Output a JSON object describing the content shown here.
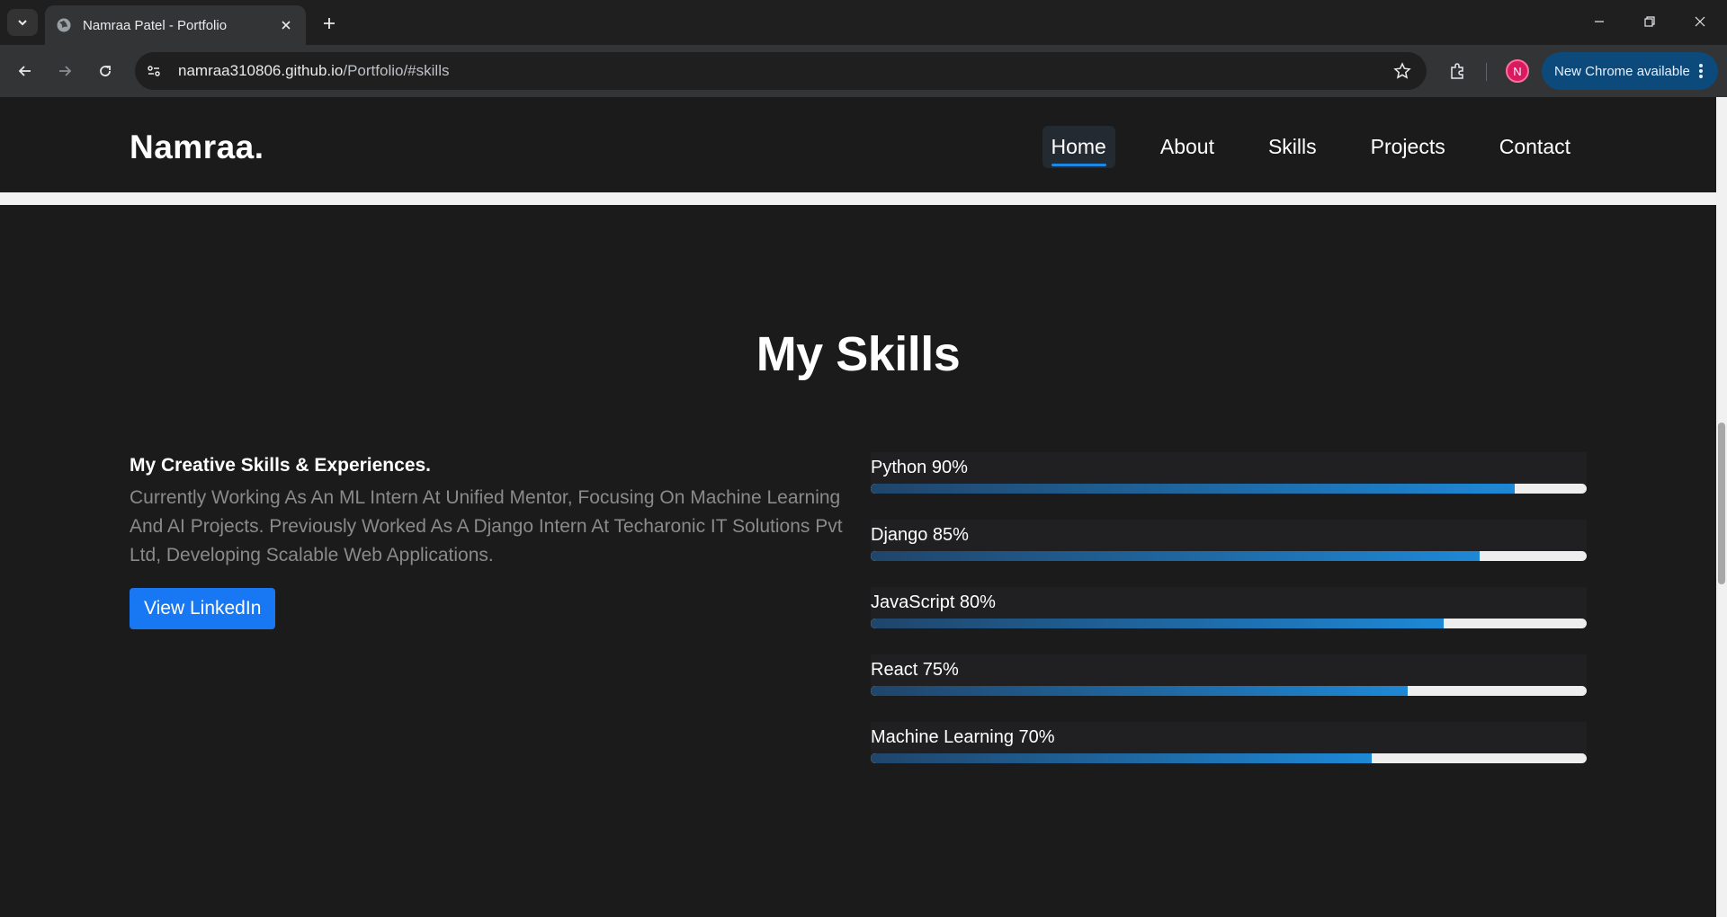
{
  "browser": {
    "tab_title": "Namraa Patel - Portfolio",
    "url_host": "namraa310806.github.io",
    "url_path": "/Portfolio/#skills",
    "profile_initial": "N",
    "update_label": "New Chrome available"
  },
  "site": {
    "logo": "Namraa.",
    "nav": [
      {
        "label": "Home",
        "active": true
      },
      {
        "label": "About"
      },
      {
        "label": "Skills"
      },
      {
        "label": "Projects"
      },
      {
        "label": "Contact"
      }
    ]
  },
  "skills_section": {
    "title": "My Skills",
    "heading": "My Creative Skills & Experiences.",
    "text": "Currently Working As An ML Intern At Unified Mentor, Focusing On Machine Learning And AI Projects. Previously Worked As A Django Intern At Techaronic IT Solutions Pvt Ltd, Developing Scalable Web Applications.",
    "button_label": "View LinkedIn",
    "skills": [
      {
        "label": "Python 90%",
        "level": 90
      },
      {
        "label": "Django 85%",
        "level": 85
      },
      {
        "label": "JavaScript 80%",
        "level": 80
      },
      {
        "label": "React 75%",
        "level": 75
      },
      {
        "label": "Machine Learning 70%",
        "level": 70
      }
    ]
  },
  "colors": {
    "accent": "#1877f2",
    "bar_fill": "#1e88d6",
    "background": "#1b1b1c"
  }
}
